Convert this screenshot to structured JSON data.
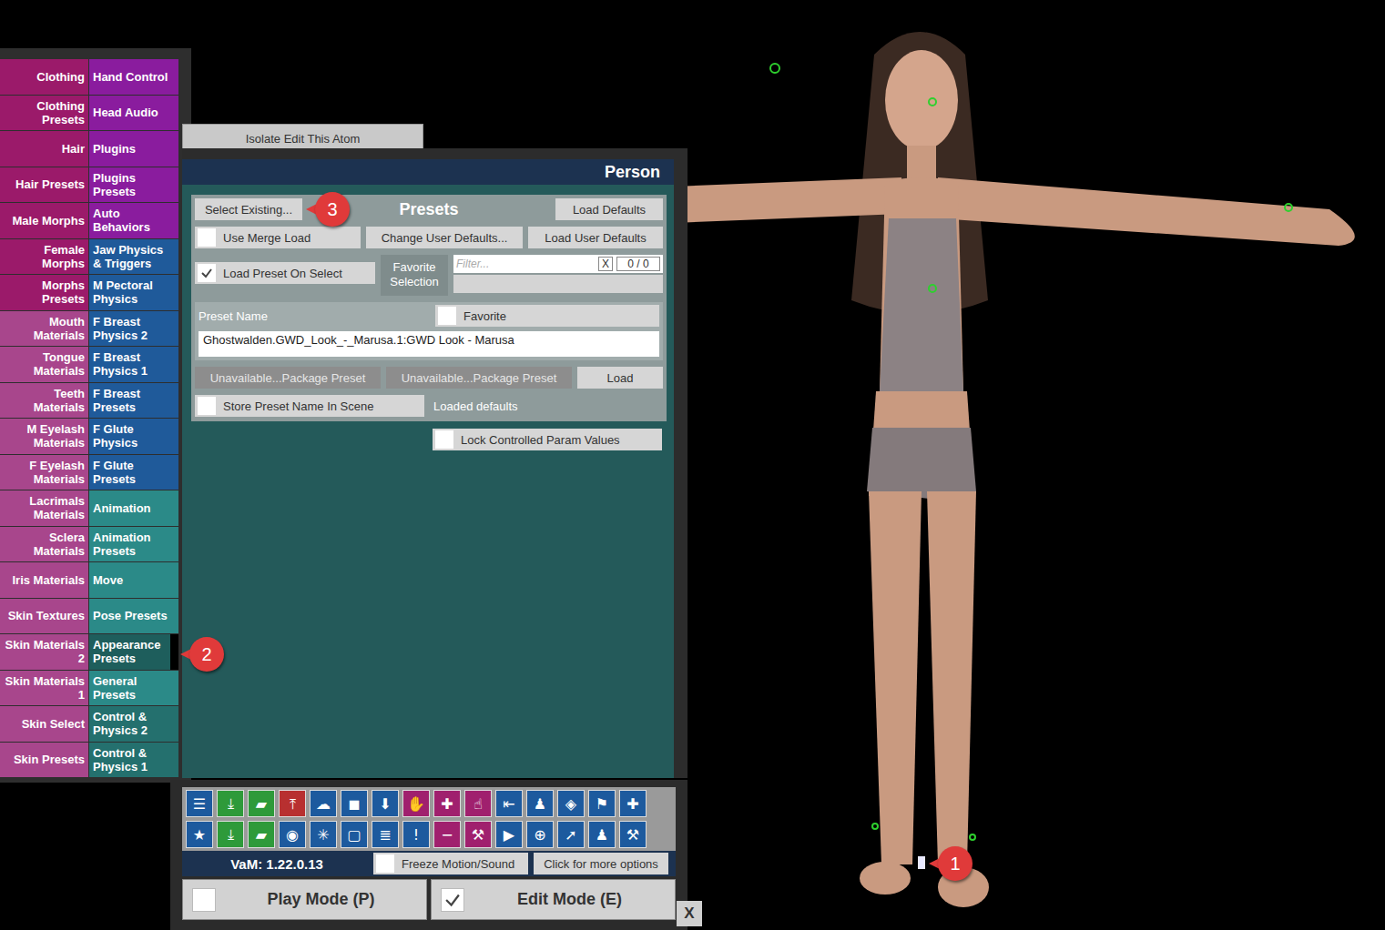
{
  "tab_menu": {
    "rows": [
      {
        "left": {
          "label": "Clothing",
          "selected": false,
          "color": "#9b1a6a"
        },
        "right": {
          "label": "Hand Control",
          "selected": false,
          "color": "#8a1c9e"
        }
      },
      {
        "left": {
          "label": "Clothing Presets",
          "selected": false,
          "color": "#9b1a6a"
        },
        "right": {
          "label": "Head Audio",
          "selected": false,
          "color": "#8a1c9e"
        }
      },
      {
        "left": {
          "label": "Hair",
          "selected": false,
          "color": "#9b1a6a"
        },
        "right": {
          "label": "Plugins",
          "selected": false,
          "color": "#8a1c9e"
        }
      },
      {
        "left": {
          "label": "Hair Presets",
          "selected": false,
          "color": "#9b1a6a"
        },
        "right": {
          "label": "Plugins Presets",
          "selected": false,
          "color": "#8a1c9e"
        }
      },
      {
        "left": {
          "label": "Male Morphs",
          "selected": false,
          "color": "#9b1a6a"
        },
        "right": {
          "label": "Auto Behaviors",
          "selected": false,
          "color": "#8a1c9e"
        }
      },
      {
        "left": {
          "label": "Female Morphs",
          "selected": false,
          "color": "#9b1a6a"
        },
        "right": {
          "label": "Jaw Physics & Triggers",
          "selected": false,
          "color": "#1f5a9a"
        }
      },
      {
        "left": {
          "label": "Morphs Presets",
          "selected": false,
          "color": "#9b1a6a"
        },
        "right": {
          "label": "M Pectoral Physics",
          "selected": false,
          "color": "#1f5a9a"
        }
      },
      {
        "left": {
          "label": "Mouth Materials",
          "selected": false,
          "color": "#a8468c"
        },
        "right": {
          "label": "F Breast Physics 2",
          "selected": false,
          "color": "#1f5a9a"
        }
      },
      {
        "left": {
          "label": "Tongue Materials",
          "selected": false,
          "color": "#a8468c"
        },
        "right": {
          "label": "F Breast Physics 1",
          "selected": false,
          "color": "#1f5a9a"
        }
      },
      {
        "left": {
          "label": "Teeth Materials",
          "selected": false,
          "color": "#a8468c"
        },
        "right": {
          "label": "F Breast Presets",
          "selected": false,
          "color": "#1f5a9a"
        }
      },
      {
        "left": {
          "label": "M Eyelash Materials",
          "selected": false,
          "color": "#a8468c"
        },
        "right": {
          "label": "F Glute Physics",
          "selected": false,
          "color": "#1f5a9a"
        }
      },
      {
        "left": {
          "label": "F Eyelash Materials",
          "selected": false,
          "color": "#a8468c"
        },
        "right": {
          "label": "F Glute Presets",
          "selected": false,
          "color": "#1f5a9a"
        }
      },
      {
        "left": {
          "label": "Lacrimals Materials",
          "selected": false,
          "color": "#a8468c"
        },
        "right": {
          "label": "Animation",
          "selected": false,
          "color": "#2b8a88"
        }
      },
      {
        "left": {
          "label": "Sclera Materials",
          "selected": false,
          "color": "#a8468c"
        },
        "right": {
          "label": "Animation Presets",
          "selected": false,
          "color": "#2b8a88"
        }
      },
      {
        "left": {
          "label": "Iris Materials",
          "selected": false,
          "color": "#a8468c"
        },
        "right": {
          "label": "Move",
          "selected": false,
          "color": "#2b8a88"
        }
      },
      {
        "left": {
          "label": "Skin Textures",
          "selected": false,
          "color": "#a8468c"
        },
        "right": {
          "label": "Pose Presets",
          "selected": false,
          "color": "#2b8a88"
        }
      },
      {
        "left": {
          "label": "Skin Materials 2",
          "selected": false,
          "color": "#a8468c"
        },
        "right": {
          "label": "Appearance Presets",
          "selected": true,
          "color": "#1e5e5c"
        }
      },
      {
        "left": {
          "label": "Skin Materials 1",
          "selected": false,
          "color": "#a8468c"
        },
        "right": {
          "label": "General Presets",
          "selected": false,
          "color": "#2b8a88"
        }
      },
      {
        "left": {
          "label": "Skin Select",
          "selected": false,
          "color": "#a8468c"
        },
        "right": {
          "label": "Control & Physics 2",
          "selected": false,
          "color": "#24706e"
        }
      },
      {
        "left": {
          "label": "Skin Presets",
          "selected": false,
          "color": "#a8468c"
        },
        "right": {
          "label": "Control & Physics 1",
          "selected": false,
          "color": "#24706e"
        }
      }
    ]
  },
  "isolate_button": "Isolate Edit This Atom",
  "panel": {
    "title": "Person",
    "presets": {
      "title": "Presets",
      "select_existing": "Select Existing...",
      "load_defaults": "Load Defaults",
      "merge_load": {
        "label": "Use Merge Load",
        "checked": false
      },
      "change_user_defaults": "Change User Defaults...",
      "load_user_defaults": "Load User Defaults",
      "load_on_select": {
        "label": "Load Preset On Select",
        "checked": true
      },
      "favorite_selection_label": "Favorite Selection",
      "filter": {
        "placeholder": "Filter...",
        "clear": "X",
        "count": "0 / 0"
      },
      "preset_name_label": "Preset Name",
      "favorite": {
        "label": "Favorite",
        "checked": false
      },
      "preset_name_value": "Ghostwalden.GWD_Look_-_Marusa.1:GWD Look - Marusa",
      "package_buttons": [
        {
          "label": "Unavailable...Package Preset",
          "disabled": true
        },
        {
          "label": "Unavailable...Package Preset",
          "disabled": true
        }
      ],
      "load": "Load",
      "store_name": {
        "label": "Store Preset Name In Scene",
        "checked": false
      },
      "status": "Loaded defaults"
    },
    "lock_params": {
      "label": "Lock Controlled Param Values",
      "checked": false
    }
  },
  "toolbar": {
    "rows": [
      [
        {
          "glyph": "☰",
          "color": "#1d5a9e"
        },
        {
          "glyph": "⤓",
          "color": "#2e9a3a"
        },
        {
          "glyph": "▰",
          "color": "#2e9a3a"
        },
        {
          "glyph": "⤒",
          "color": "#b83030"
        },
        {
          "glyph": "☁",
          "color": "#1d5a9e"
        },
        {
          "glyph": "◼",
          "color": "#1d5a9e"
        },
        {
          "glyph": "⬇",
          "color": "#1d5a9e"
        },
        {
          "glyph": "✋",
          "color": "#a0206e"
        },
        {
          "glyph": "✚",
          "color": "#a0206e"
        },
        {
          "glyph": "☝",
          "color": "#a0206e"
        },
        {
          "glyph": "⇤",
          "color": "#1d5a9e"
        },
        {
          "glyph": "♟",
          "color": "#1d5a9e"
        },
        {
          "glyph": "◈",
          "color": "#1d5a9e"
        },
        {
          "glyph": "⚑",
          "color": "#1d5a9e"
        },
        {
          "glyph": "✚",
          "color": "#1d5a9e"
        }
      ],
      [
        {
          "glyph": "★",
          "color": "#1d5a9e"
        },
        {
          "glyph": "⤓",
          "color": "#2e9a3a"
        },
        {
          "glyph": "▰",
          "color": "#2e9a3a"
        },
        {
          "glyph": "◉",
          "color": "#1d5a9e"
        },
        {
          "glyph": "✳",
          "color": "#1d5a9e"
        },
        {
          "glyph": "▢",
          "color": "#1d5a9e"
        },
        {
          "glyph": "≣",
          "color": "#1d5a9e"
        },
        {
          "glyph": "!",
          "color": "#1d5a9e"
        },
        {
          "glyph": "−",
          "color": "#a0206e"
        },
        {
          "glyph": "⚒",
          "color": "#a0206e"
        },
        {
          "glyph": "▶",
          "color": "#1d5a9e"
        },
        {
          "glyph": "⊕",
          "color": "#1d5a9e"
        },
        {
          "glyph": "➚",
          "color": "#1d5a9e"
        },
        {
          "glyph": "♟",
          "color": "#1d5a9e"
        },
        {
          "glyph": "⚒",
          "color": "#1d5a9e"
        }
      ]
    ]
  },
  "status_bar": {
    "version": "VaM: 1.22.0.13",
    "freeze": {
      "label": "Freeze Motion/Sound",
      "checked": false
    },
    "more_button": "Click for more options"
  },
  "modes": [
    {
      "label": "Play Mode (P)",
      "checked": false
    },
    {
      "label": "Edit Mode (E)",
      "checked": true
    }
  ],
  "close_button": "X",
  "callouts": [
    {
      "number": "1"
    },
    {
      "number": "2"
    },
    {
      "number": "3"
    }
  ]
}
